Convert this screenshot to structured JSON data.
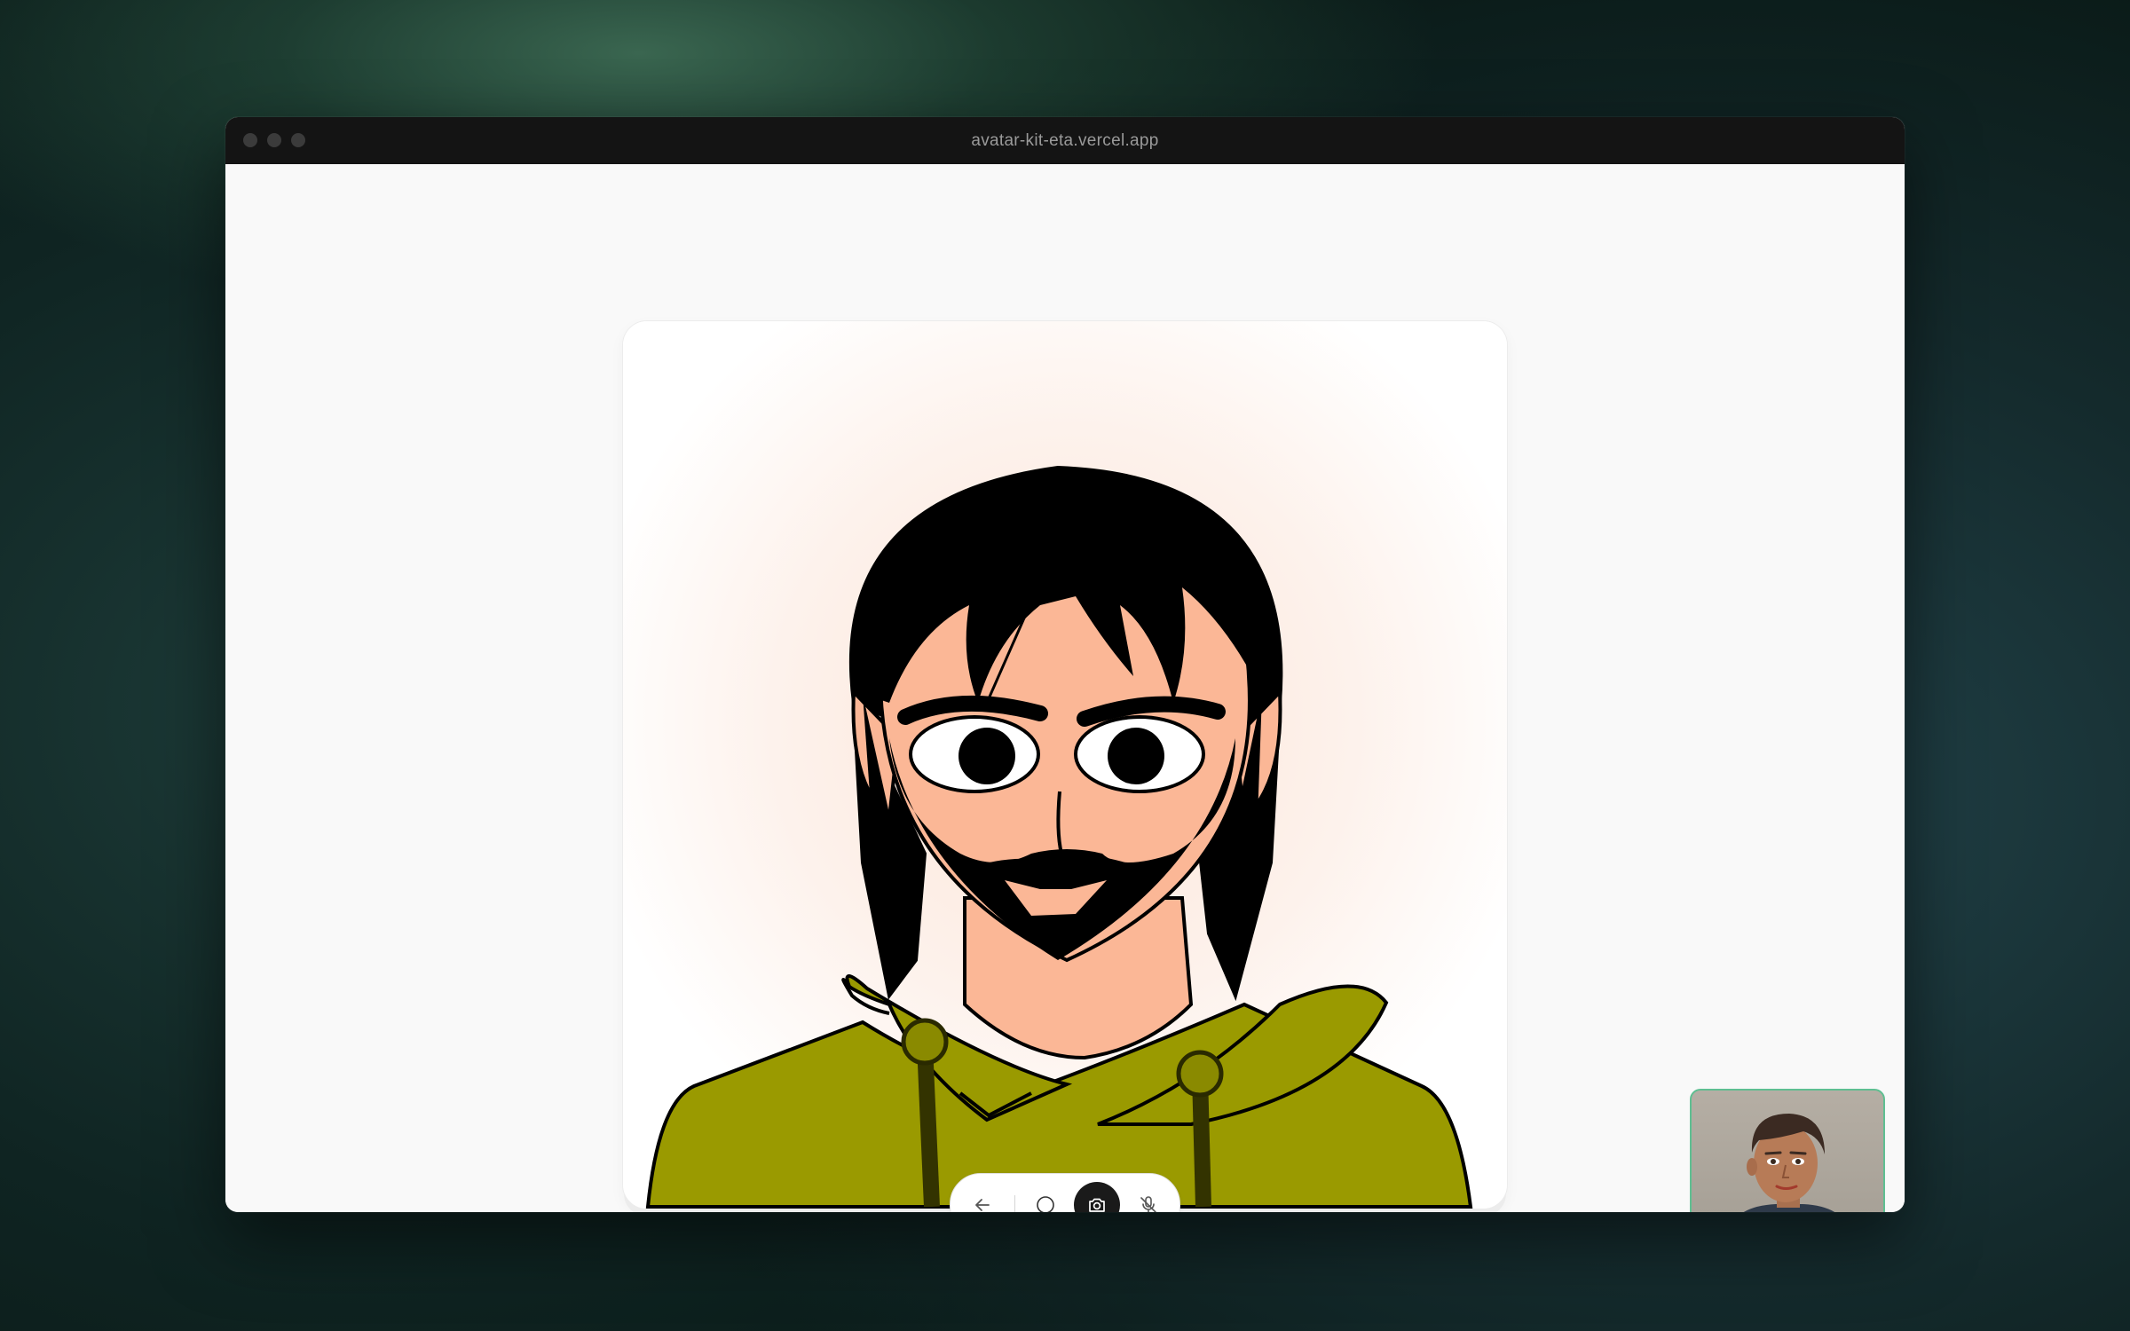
{
  "window": {
    "url": "avatar-kit-eta.vercel.app"
  },
  "avatar": {
    "skin_color": "#fbb796",
    "hair_color": "#000000",
    "hoodie_color": "#9a9a00"
  },
  "controls": {
    "back_icon": "arrow-left-icon",
    "record_icon": "circle-icon",
    "camera_icon": "camera-icon",
    "mic_icon": "mic-off-icon",
    "active_color": "#1a1a1a"
  },
  "self_view": {
    "border_color": "#5fbf92"
  }
}
